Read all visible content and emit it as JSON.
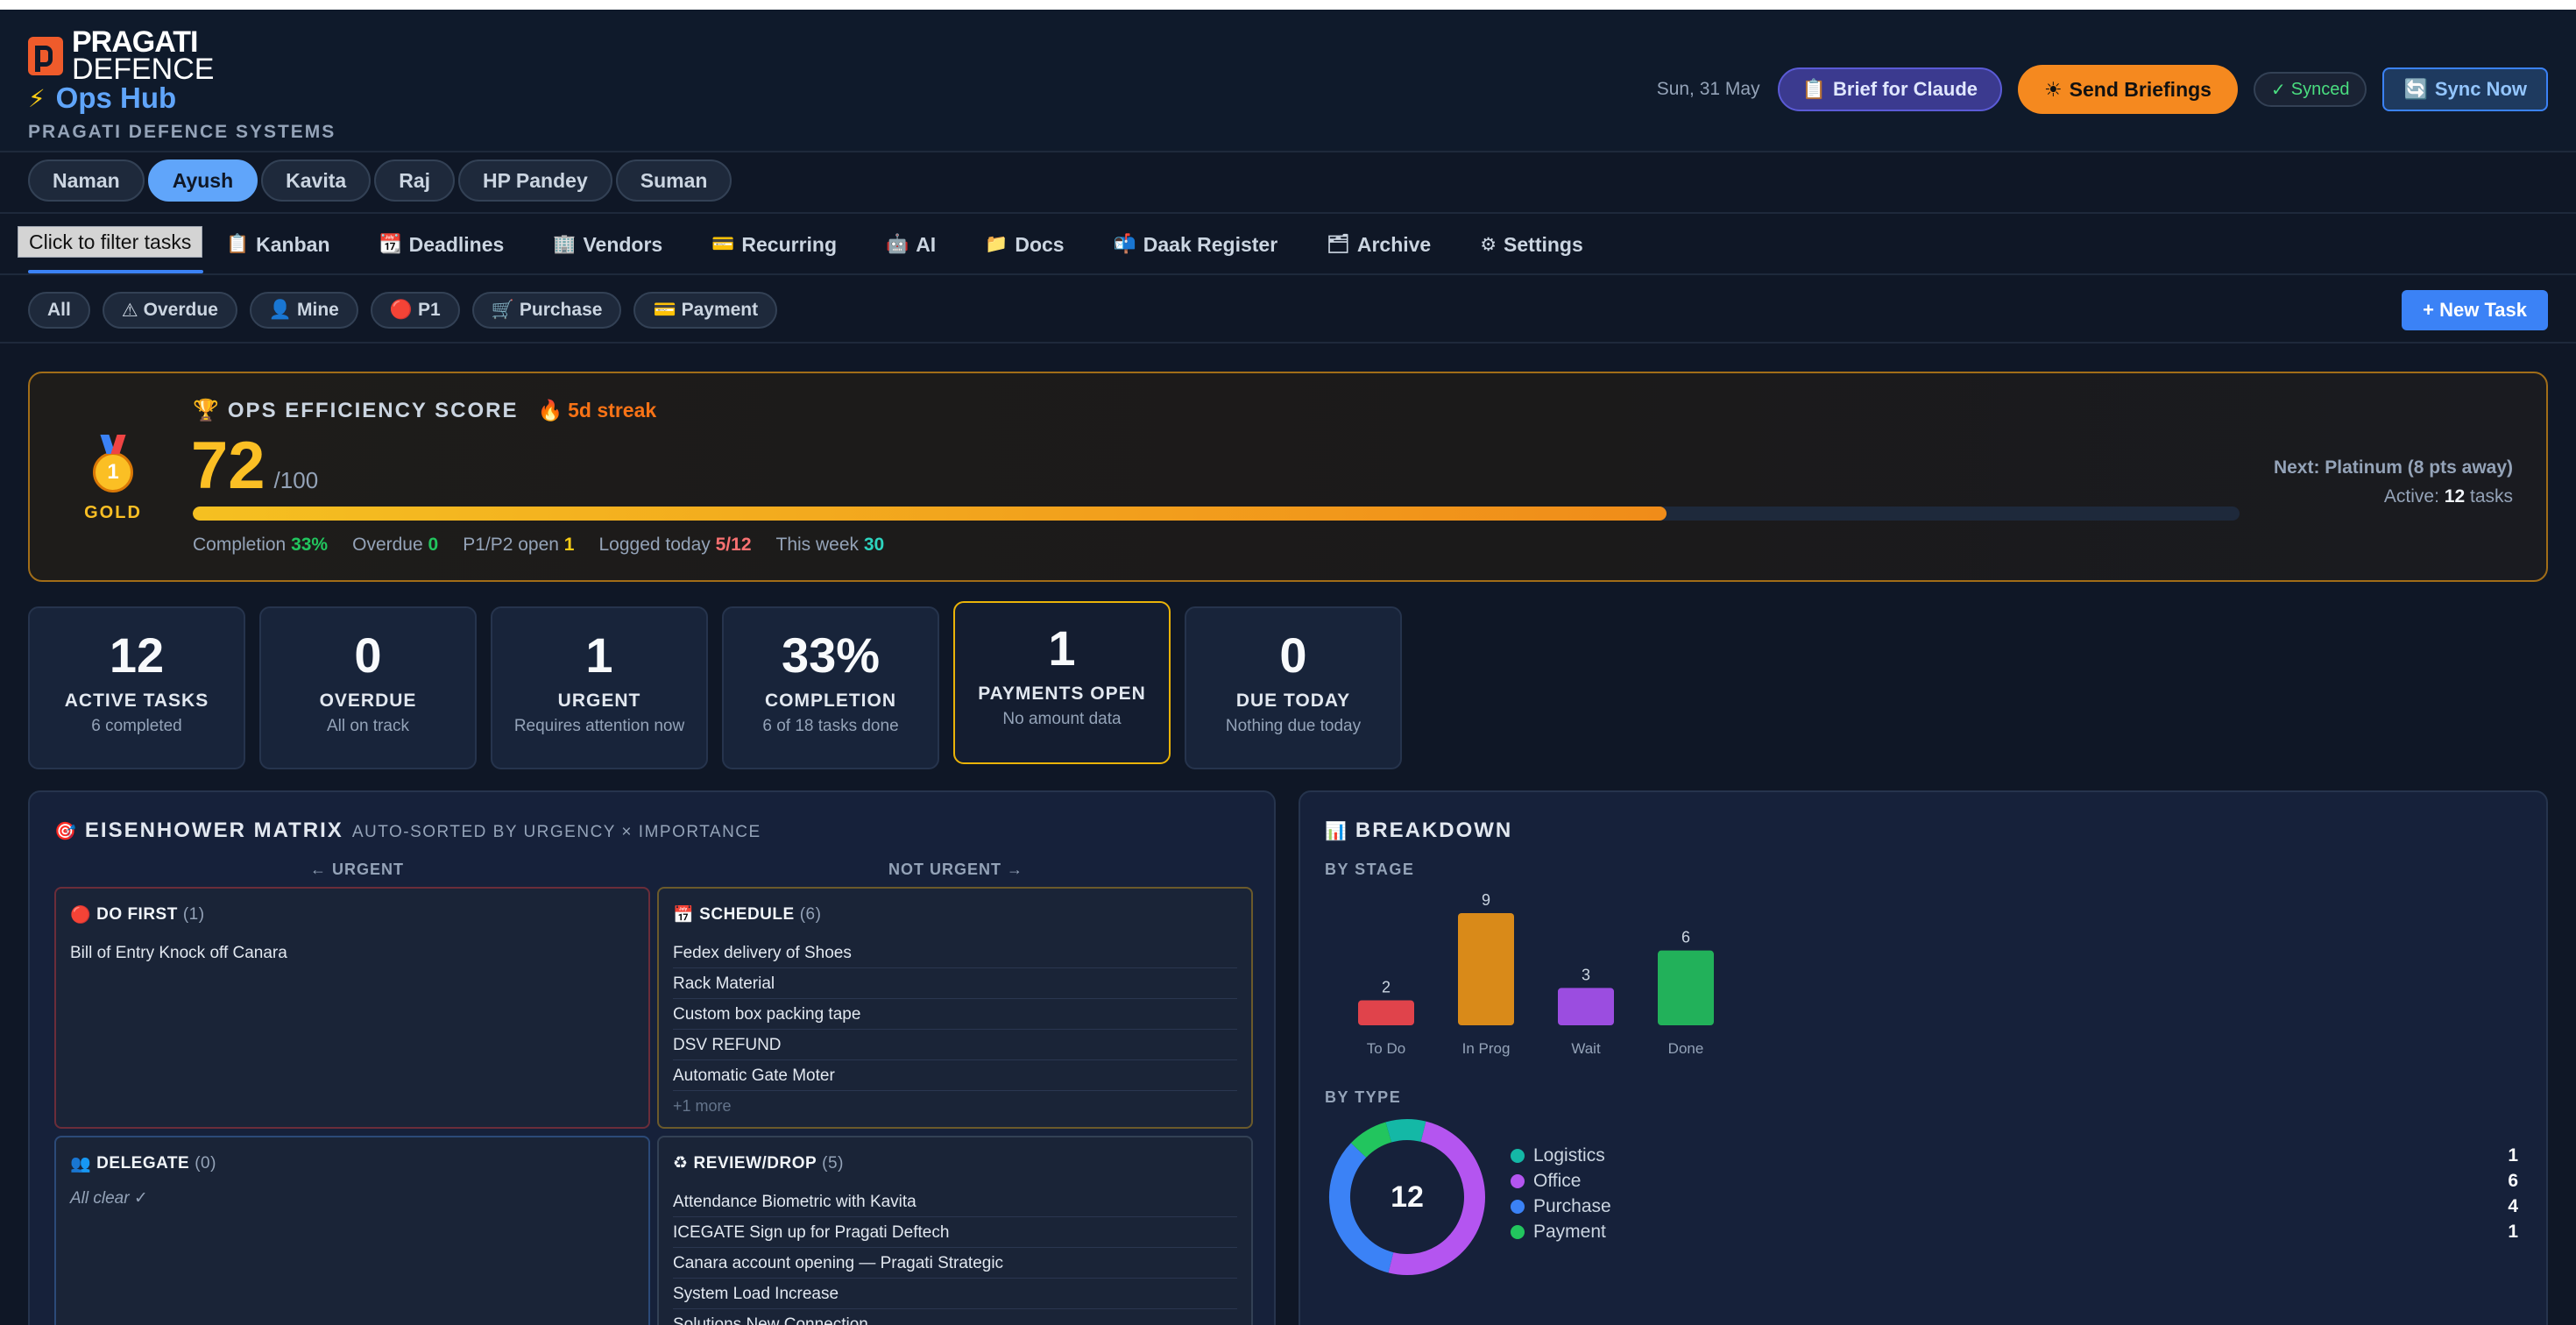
{
  "header": {
    "logo_line1": "PRAGATI",
    "logo_line2": "DEFENCE",
    "app_title": "Ops Hub",
    "app_subtitle": "PRAGATI DEFENCE SYSTEMS",
    "date": "Sun, 31 May",
    "brief_label": "Brief for Claude",
    "send_label": "Send Briefings",
    "synced_label": "Synced",
    "sync_now_label": "Sync Now"
  },
  "people": [
    "Naman",
    "Ayush",
    "Kavita",
    "Raj",
    "HP Pandey",
    "Suman"
  ],
  "active_person": "Ayush",
  "tooltip": "Click to filter tasks",
  "tabs": [
    {
      "icon": "📋",
      "label": "Kanban"
    },
    {
      "icon": "📆",
      "label": "Deadlines"
    },
    {
      "icon": "🏢",
      "label": "Vendors"
    },
    {
      "icon": "💳",
      "label": "Recurring"
    },
    {
      "icon": "🤖",
      "label": "AI"
    },
    {
      "icon": "📁",
      "label": "Docs"
    },
    {
      "icon": "📬",
      "label": "Daak Register"
    },
    {
      "icon": "🗂",
      "label": "Archive"
    },
    {
      "icon": "⚙",
      "label": "Settings"
    }
  ],
  "filters": [
    {
      "icon": "",
      "label": "All"
    },
    {
      "icon": "⚠",
      "label": "Overdue"
    },
    {
      "icon": "👤",
      "label": "Mine"
    },
    {
      "icon": "🔴",
      "label": "P1"
    },
    {
      "icon": "🛒",
      "label": "Purchase"
    },
    {
      "icon": "💳",
      "label": "Payment"
    }
  ],
  "new_task_label": "+ New Task",
  "score": {
    "title": "OPS EFFICIENCY SCORE",
    "streak": "5d streak",
    "value": "72",
    "max": "/100",
    "progress": 0.72,
    "tier": "GOLD",
    "medal_number": "1",
    "stats": [
      {
        "label": "Completion",
        "value": "33%",
        "color": "g"
      },
      {
        "label": "Overdue",
        "value": "0",
        "color": "g"
      },
      {
        "label": "P1/P2 open",
        "value": "1",
        "color": "y"
      },
      {
        "label": "Logged today",
        "value": "5/12",
        "color": "r"
      },
      {
        "label": "This week",
        "value": "30",
        "color": "t"
      }
    ],
    "next_label": "Next: Platinum (8 pts away)",
    "active_prefix": "Active:",
    "active_count": "12",
    "active_suffix": "tasks"
  },
  "cards": [
    {
      "num": "12",
      "label": "ACTIVE TASKS",
      "sub": "6 completed"
    },
    {
      "num": "0",
      "label": "OVERDUE",
      "sub": "All on track"
    },
    {
      "num": "1",
      "label": "URGENT",
      "sub": "Requires attention now"
    },
    {
      "num": "33%",
      "label": "COMPLETION",
      "sub": "6 of 18 tasks done"
    },
    {
      "num": "1",
      "label": "PAYMENTS OPEN",
      "sub": "No amount data"
    },
    {
      "num": "0",
      "label": "DUE TODAY",
      "sub": "Nothing due today"
    }
  ],
  "matrix": {
    "title": "EISENHOWER MATRIX",
    "hint": "AUTO-SORTED BY URGENCY × IMPORTANCE",
    "axis_left": "← URGENT",
    "axis_right": "NOT URGENT →",
    "do_first": {
      "icon": "🔴",
      "title": "DO FIRST",
      "count": "(1)",
      "items": [
        "Bill of Entry Knock off Canara"
      ]
    },
    "schedule": {
      "icon": "📅",
      "title": "SCHEDULE",
      "count": "(6)",
      "items": [
        "Fedex delivery of Shoes",
        "Rack Material",
        "Custom box packing tape",
        "DSV REFUND",
        "Automatic Gate Moter"
      ],
      "more": "+1 more"
    },
    "delegate": {
      "icon": "👥",
      "title": "DELEGATE",
      "count": "(0)",
      "empty": "All clear ✓"
    },
    "review": {
      "icon": "♻",
      "title": "REVIEW/DROP",
      "count": "(5)",
      "items": [
        "Attendance Biometric with Kavita",
        "ICEGATE Sign up for Pragati Deftech",
        "Canara account opening — Pragati Strategic",
        "System Load Increase",
        "Solutions New Connection"
      ]
    }
  },
  "breakdown": {
    "title": "BREAKDOWN",
    "by_stage_label": "BY STAGE",
    "by_type_label": "BY TYPE",
    "donut_total": "12"
  },
  "chart_data": [
    {
      "type": "bar",
      "categories": [
        "To Do",
        "In Prog",
        "Wait",
        "Done"
      ],
      "values": [
        2,
        9,
        3,
        6
      ],
      "colors": [
        "#e0434b",
        "#d98a19",
        "#9b4de0",
        "#22b15a"
      ],
      "title": "BY STAGE"
    },
    {
      "type": "pie",
      "categories": [
        "Logistics",
        "Office",
        "Purchase",
        "Payment"
      ],
      "values": [
        1,
        6,
        4,
        1
      ],
      "colors": [
        "#14b8a6",
        "#b455f0",
        "#3b82f6",
        "#22c55e"
      ],
      "title": "BY TYPE"
    }
  ]
}
